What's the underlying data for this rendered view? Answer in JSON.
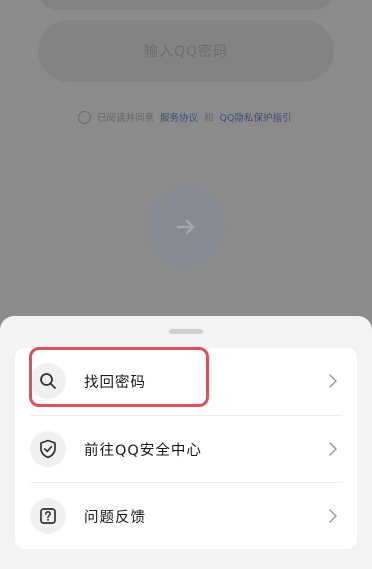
{
  "background": {
    "password_placeholder": "输入QQ密码",
    "agree_prefix": "已阅读并同意",
    "agree_link_terms": "服务协议",
    "agree_and": "和",
    "agree_link_privacy": "QQ隐私保护指引",
    "go_icon": "arrow-right-icon"
  },
  "sheet": {
    "items": [
      {
        "label": "找回密码",
        "icon": "search-icon"
      },
      {
        "label": "前往QQ安全中心",
        "icon": "shield-check-icon"
      },
      {
        "label": "问题反馈",
        "icon": "question-icon"
      }
    ]
  },
  "colors": {
    "highlight": "#e0505c",
    "link": "#42507a"
  }
}
